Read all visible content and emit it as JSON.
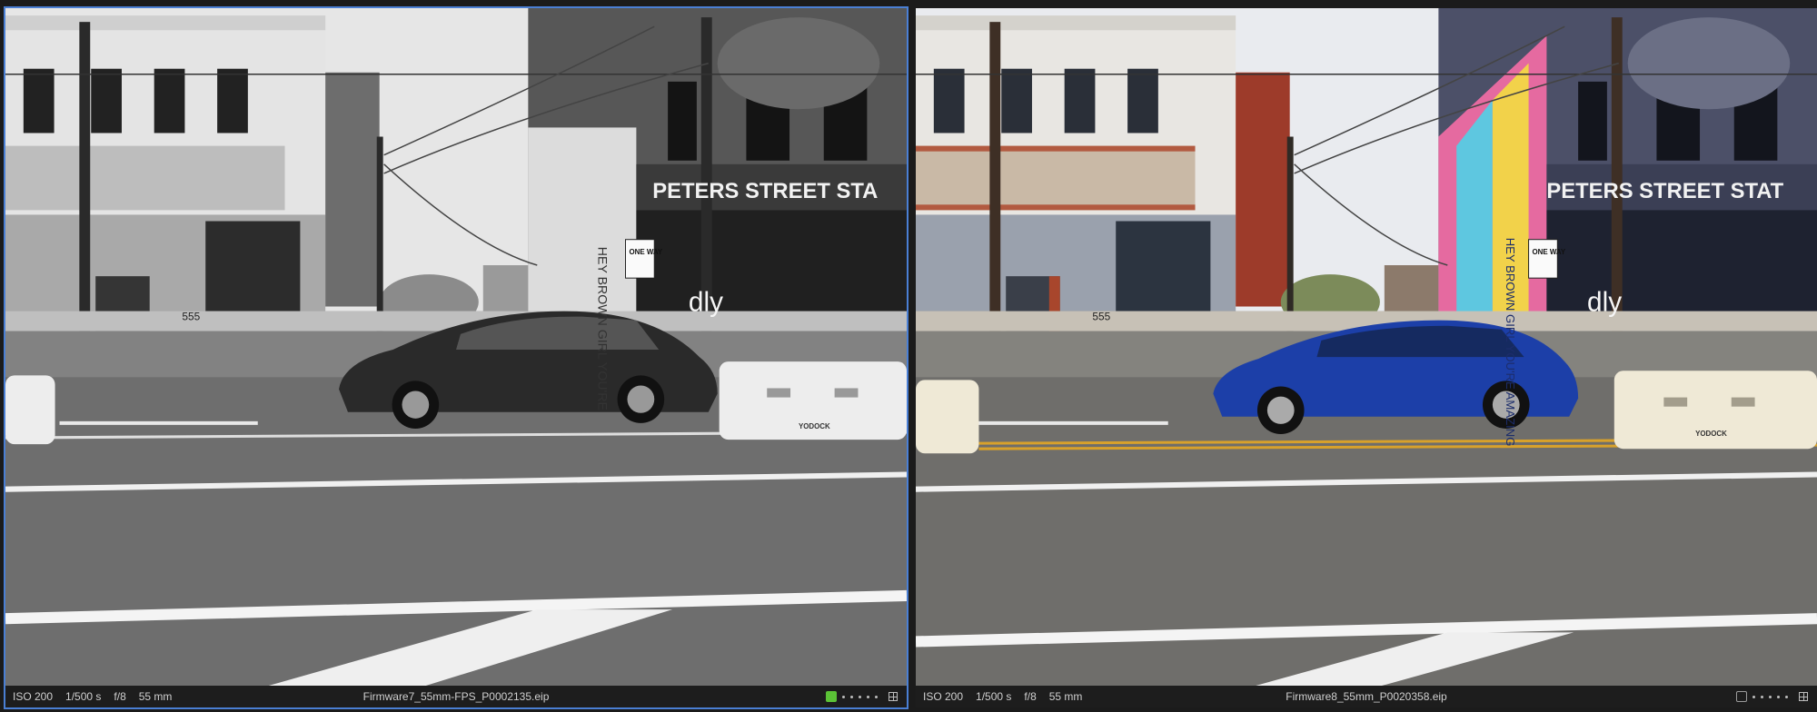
{
  "panes": [
    {
      "iso": "ISO 200",
      "shutter": "1/500 s",
      "aperture": "f/8",
      "focal": "55 mm",
      "filename": "Firmware7_55mm-FPS_P0002135.eip",
      "label_color": "#5bc236",
      "selected": true,
      "style": "monochrome",
      "sign_text": "PETERS STREET STA",
      "mural_text": "HEY BROWN GIRL YOU'RE",
      "address": "555",
      "oneway": "ONE WAY",
      "barrier_text": "YODOCK",
      "logo_text": "dly"
    },
    {
      "iso": "ISO 200",
      "shutter": "1/500 s",
      "aperture": "f/8",
      "focal": "55 mm",
      "filename": "Firmware8_55mm_P0020358.eip",
      "label_color": "",
      "selected": false,
      "style": "color",
      "sign_text": "PETERS STREET STAT",
      "mural_text": "HEY BROWN GIRL YOU'RE AMAZING",
      "address": "555",
      "oneway": "ONE WAY",
      "barrier_text": "YODOCK",
      "logo_text": "dly"
    }
  ],
  "colors": {
    "selection_border": "#4a7fd4",
    "car_color": "#1c3fa8",
    "car_mono": "#2a2a2a"
  }
}
